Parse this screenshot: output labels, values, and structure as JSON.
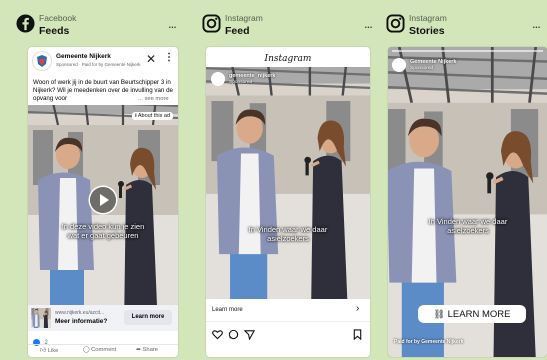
{
  "placements": [
    {
      "platform": "Facebook",
      "placement": "Feeds",
      "menu": "...",
      "advertiser": "Gemeente Nijkerk",
      "sponsored": "Sponsored · Paid for by Gemeente Nijkerk",
      "body_text": "Woon of werk jij in de buurt van Beurtschipper 3 in Nijkerk? Wil je meedenken over de invulling van de opvang voor",
      "see_more": "... see more",
      "about_ad": "About this ad",
      "video_caption": "In deze video kun je zien\nwat er gaat gebeuren",
      "link_domain": "www.nijkerk.eu/azcit...",
      "link_title": "Meer informatie?",
      "cta": "Learn more",
      "reaction_count": "2",
      "actions": [
        "Like",
        "Comment",
        "Share"
      ]
    },
    {
      "platform": "Instagram",
      "placement": "Feed",
      "menu": "...",
      "logo_text": "Instagram",
      "account": "gemeente_nijkerk",
      "sponsored": "Sponsored",
      "video_caption": "In Vinden waar we daar\nasielzoekers",
      "cta": "Learn more"
    },
    {
      "platform": "Instagram",
      "placement": "Stories",
      "menu": "...",
      "account": "Gemeente Nijkerk",
      "sponsored": "Sponsored",
      "video_caption": "In Vinden waar we daar\nasielzoekers",
      "cta": "LEARN MORE",
      "paid_for": "Paid for by Gemeente Nijkerk"
    }
  ],
  "colors": {
    "background": "#d3e6b9",
    "facebook_blue": "#1877f2",
    "text_dark": "#111111"
  },
  "icons": [
    "facebook-icon",
    "instagram-icon",
    "close-icon",
    "info-icon",
    "play-icon",
    "heart-icon",
    "comment-icon",
    "send-icon",
    "bookmark-icon",
    "chevron-right-icon",
    "link-icon",
    "like-icon",
    "share-icon"
  ]
}
